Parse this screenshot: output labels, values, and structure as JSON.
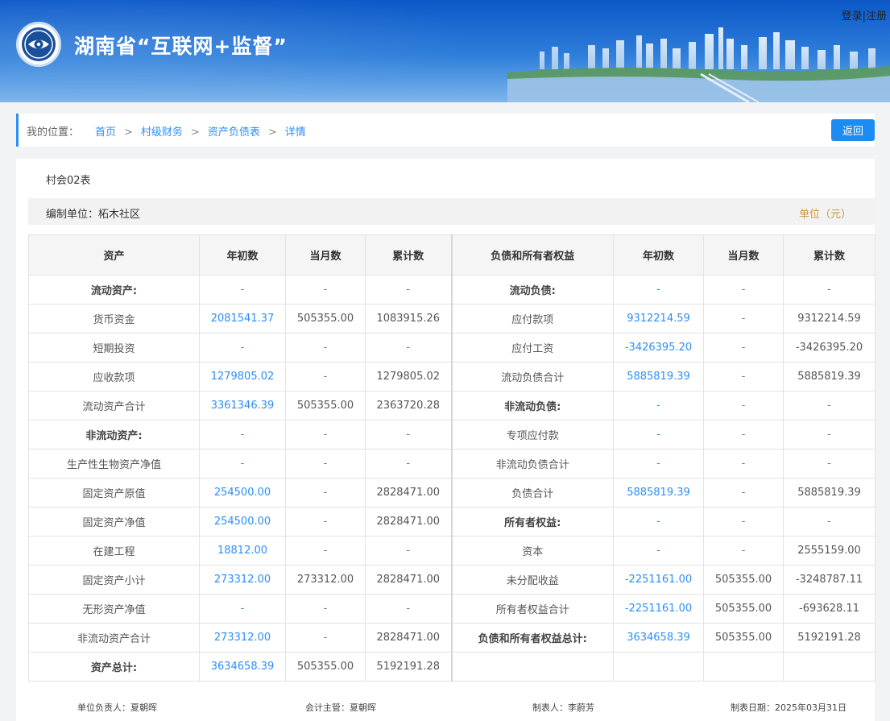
{
  "header": {
    "title": "湖南省“互联网+监督”",
    "login": "登录",
    "sep": "|",
    "register": "注册"
  },
  "breadcrumb": {
    "label": "我的位置：",
    "items": [
      "首页",
      "村级财务",
      "资产负债表",
      "详情"
    ],
    "sep": ">",
    "back": "返回"
  },
  "report": {
    "form_code": "村会02表",
    "unit_label": "编制单位：柘木社区",
    "currency": "单位（元）"
  },
  "table": {
    "headers": [
      "资产",
      "年初数",
      "当月数",
      "累计数",
      "负债和所有者权益",
      "年初数",
      "当月数",
      "累计数"
    ],
    "rows": [
      [
        "流动资产:",
        "-",
        "-",
        "-",
        "流动负债:",
        "-",
        "-",
        "-"
      ],
      [
        "货币资金",
        "2081541.37",
        "505355.00",
        "1083915.26",
        "应付款项",
        "9312214.59",
        "-",
        "9312214.59"
      ],
      [
        "短期投资",
        "-",
        "-",
        "-",
        "应付工资",
        "-3426395.20",
        "-",
        "-3426395.20"
      ],
      [
        "应收款项",
        "1279805.02",
        "-",
        "1279805.02",
        "流动负债合计",
        "5885819.39",
        "-",
        "5885819.39"
      ],
      [
        "流动资产合计",
        "3361346.39",
        "505355.00",
        "2363720.28",
        "非流动负债:",
        "-",
        "-",
        "-"
      ],
      [
        "非流动资产:",
        "-",
        "-",
        "-",
        "专项应付款",
        "-",
        "-",
        "-"
      ],
      [
        "生产性生物资产净值",
        "-",
        "-",
        "-",
        "非流动负债合计",
        "-",
        "-",
        "-"
      ],
      [
        "固定资产原值",
        "254500.00",
        "-",
        "2828471.00",
        "负债合计",
        "5885819.39",
        "-",
        "5885819.39"
      ],
      [
        "固定资产净值",
        "254500.00",
        "-",
        "2828471.00",
        "所有者权益:",
        "-",
        "-",
        "-"
      ],
      [
        "在建工程",
        "18812.00",
        "-",
        "-",
        "资本",
        "-",
        "-",
        "2555159.00"
      ],
      [
        "固定资产小计",
        "273312.00",
        "273312.00",
        "2828471.00",
        "未分配收益",
        "-2251161.00",
        "505355.00",
        "-3248787.11"
      ],
      [
        "无形资产净值",
        "-",
        "-",
        "-",
        "所有者权益合计",
        "-2251161.00",
        "505355.00",
        "-693628.11"
      ],
      [
        "非流动资产合计",
        "273312.00",
        "-",
        "2828471.00",
        "负债和所有者权益总计:",
        "3634658.39",
        "505355.00",
        "5192191.28"
      ],
      [
        "资产总计:",
        "3634658.39",
        "505355.00",
        "5192191.28",
        "",
        "",
        "",
        ""
      ]
    ],
    "bold_left": [
      0,
      5,
      13
    ],
    "bold_right": [
      0,
      4,
      8,
      12
    ]
  },
  "footer": {
    "head": "单位负责人：夏朝晖",
    "accountant": "会计主管：夏朝晖",
    "preparer": "制表人：李蔚芳",
    "date": "制表日期：2025年03月31日"
  },
  "colors": {
    "accent": "#2c8ef8",
    "unit": "#c49a3c",
    "header_dark": "#0b58c8"
  }
}
